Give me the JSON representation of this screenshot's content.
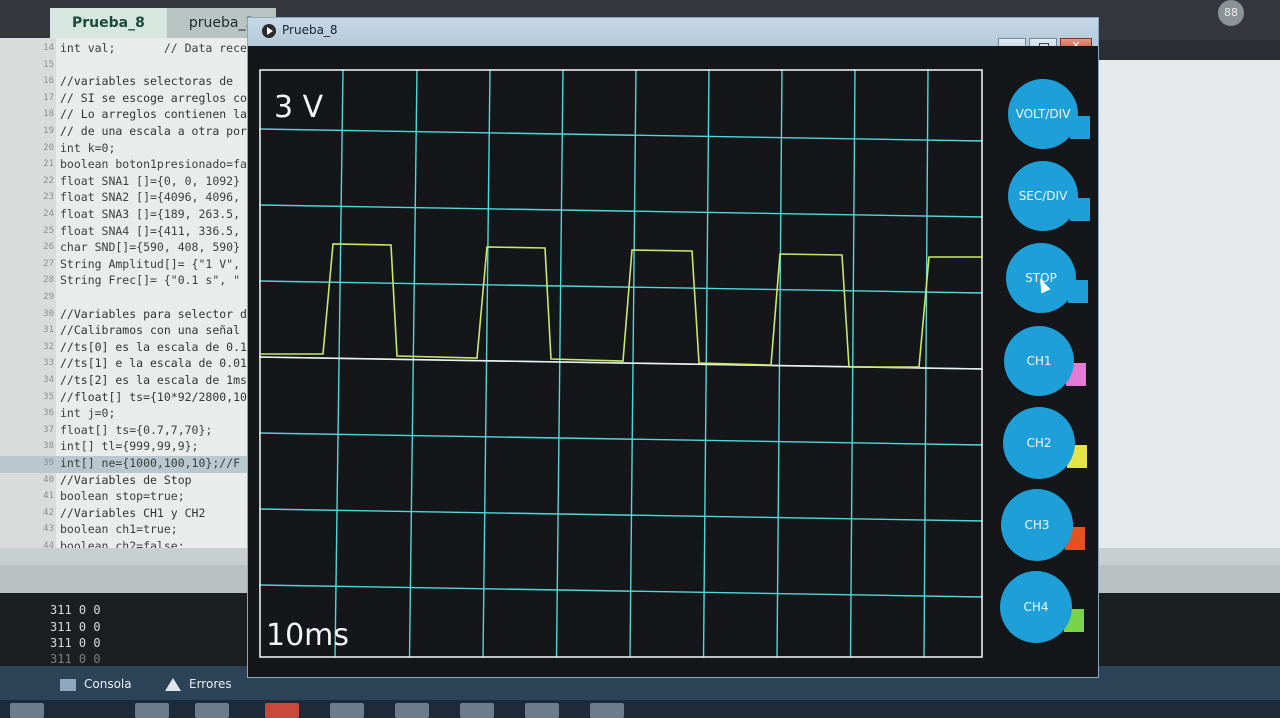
{
  "ide": {
    "tabs": [
      {
        "label": "Prueba_8",
        "active": true
      },
      {
        "label": "prueba_2",
        "active": false
      }
    ],
    "code_lines": [
      {
        "n": "14",
        "text": "int val;       // Data rece"
      },
      {
        "n": "15",
        "text": ""
      },
      {
        "n": "16",
        "text": "//variables selectoras de "
      },
      {
        "n": "17",
        "text": "// SI se escoge arreglos co"
      },
      {
        "n": "18",
        "text": "// Lo arreglos contienen la"
      },
      {
        "n": "19",
        "text": "// de una escala a otra por"
      },
      {
        "n": "20",
        "text": "int k=0;"
      },
      {
        "n": "21",
        "text": "boolean boton1presionado=fa"
      },
      {
        "n": "22",
        "text": "float SNA1 []={0, 0, 1092}"
      },
      {
        "n": "23",
        "text": "float SNA2 []={4096, 4096,"
      },
      {
        "n": "24",
        "text": "float SNA3 []={189, 263.5,"
      },
      {
        "n": "25",
        "text": "float SNA4 []={411, 336.5,"
      },
      {
        "n": "26",
        "text": "char SND[]={590, 408, 590}"
      },
      {
        "n": "27",
        "text": "String Amplitud[]= {\"1 V\","
      },
      {
        "n": "28",
        "text": "String Frec[]= {\"0.1 s\", \""
      },
      {
        "n": "29",
        "text": ""
      },
      {
        "n": "30",
        "text": "//Variables para selector d"
      },
      {
        "n": "31",
        "text": "//Calibramos con una señal"
      },
      {
        "n": "32",
        "text": "//ts[0] es la escala de 0.1"
      },
      {
        "n": "33",
        "text": "//ts[1] e la escala de 0.01"
      },
      {
        "n": "34",
        "text": "//ts[2] es la escala de 1ms"
      },
      {
        "n": "35",
        "text": "//float[] ts={10*92/2800,10"
      },
      {
        "n": "36",
        "text": "int j=0;"
      },
      {
        "n": "37",
        "text": "float[] ts={0.7,7,70};"
      },
      {
        "n": "38",
        "text": "int[] tl={999,99,9};"
      },
      {
        "n": "39",
        "text": "int[] ne={1000,100,10};//F"
      },
      {
        "n": "40",
        "text": "//Variables de Stop"
      },
      {
        "n": "41",
        "text": "boolean stop=true;"
      },
      {
        "n": "42",
        "text": "//Variables CH1 y CH2"
      },
      {
        "n": "43",
        "text": "boolean ch1=true;"
      },
      {
        "n": "44",
        "text": "boolean ch2=false;"
      }
    ],
    "console_lines": [
      "311 0 0",
      "311 0 0",
      "311 0 0",
      "311 0 0",
      "311 0 0"
    ],
    "console_tabs": {
      "console": "Consola",
      "errors": "Errores"
    },
    "corner_badge": "88"
  },
  "window": {
    "title": "Prueba_8",
    "close_glyph": "✕"
  },
  "scope": {
    "volt_div": "3 V",
    "time_div": "10ms",
    "grid_color": "#4fd8d8",
    "trace_color": "#c9e86a",
    "frame_color": "#e9ecec"
  },
  "buttons": [
    {
      "label": "VOLT/DIV",
      "tab_color": "#1f9fd8"
    },
    {
      "label": "SEC/DIV",
      "tab_color": "#1f9fd8"
    },
    {
      "label": "STOP",
      "tab_color": "#1f9fd8"
    },
    {
      "label": "CH1",
      "tab_color": "#e27ad6"
    },
    {
      "label": "CH2",
      "tab_color": "#e6e24a"
    },
    {
      "label": "CH3",
      "tab_color": "#e2531e"
    },
    {
      "label": "CH4",
      "tab_color": "#7ad34a"
    }
  ]
}
